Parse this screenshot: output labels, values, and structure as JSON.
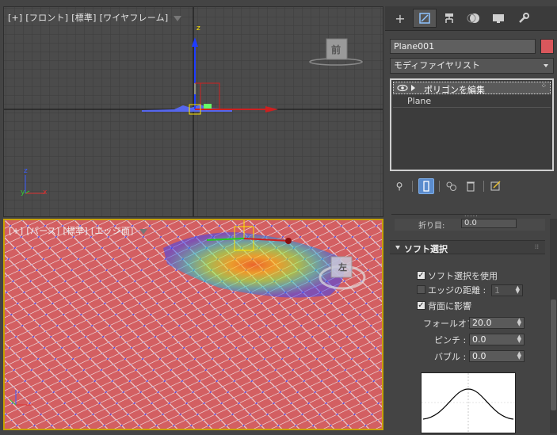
{
  "viewports": {
    "front": {
      "label_parts": [
        "[+]",
        "[フロント]",
        "[標準]",
        "[ワイヤフレーム]"
      ],
      "viewcube_face": "前",
      "axis_z": "z",
      "axis_y": "y",
      "axis_x": "x"
    },
    "perspective": {
      "label_parts": [
        "[+]",
        "[パース]",
        "[標準]",
        "[エッジ面]"
      ],
      "viewcube_face": "左"
    }
  },
  "command_panel": {
    "tabs": [
      {
        "name": "create",
        "icon": "plus-icon"
      },
      {
        "name": "modify",
        "icon": "modify-icon"
      },
      {
        "name": "hierarchy",
        "icon": "hierarchy-icon"
      },
      {
        "name": "motion",
        "icon": "motion-icon"
      },
      {
        "name": "display",
        "icon": "display-icon"
      },
      {
        "name": "utilities",
        "icon": "wrench-icon"
      }
    ],
    "object_name": "Plane001",
    "object_color": "#d9575c",
    "modifier_list_label": "モディファイヤリスト",
    "stack": {
      "modifier": "ポリゴンを編集",
      "base": "Plane"
    }
  },
  "rollout_prev": {
    "label": "折り目:",
    "value": "0.0"
  },
  "soft_selection": {
    "title": "ソフト選択",
    "use_soft_selection": {
      "label": "ソフト選択を使用",
      "checked": true
    },
    "edge_distance": {
      "label": "エッジの距離 :",
      "checked": false,
      "value": "1"
    },
    "affect_backfacing": {
      "label": "背面に影響",
      "checked": true
    },
    "falloff": {
      "label": "フォールオフ :",
      "value": "20.0"
    },
    "pinch": {
      "label": "ピンチ :",
      "value": "0.0"
    },
    "bubble": {
      "label": "バブル :",
      "value": "0.0"
    }
  },
  "colors": {
    "accent_active": "#5b8ccd",
    "viewport_active_border": "#c8a000",
    "mesh": "#d9575c"
  }
}
